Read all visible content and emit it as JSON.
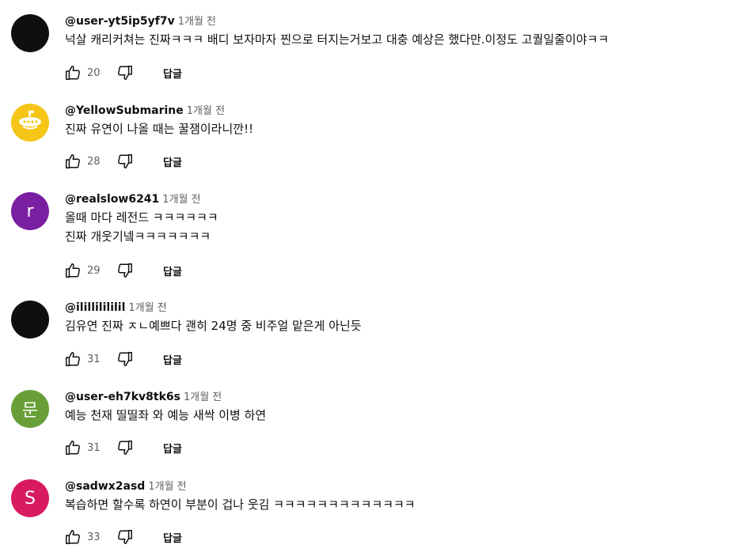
{
  "comments": [
    {
      "author": "@user-yt5ip5yf7v",
      "time": "1개월 전",
      "lines": [
        "넉살 캐리커쳐는 진짜ㅋㅋㅋ 배디 보자마자 찐으로 터지는거보고 대충 예상은 했다만.이정도 고퀄일줄이야ㅋㅋ"
      ],
      "likes": "20",
      "reply": "답글",
      "avatar_color": "#0f0f0f",
      "avatar_letter": ""
    },
    {
      "author": "@YellowSubmarine",
      "time": "1개월 전",
      "lines": [
        "진짜 유연이 나올 때는 꿀잼이라니깐!!"
      ],
      "likes": "28",
      "reply": "답글",
      "avatar_color": "#f5c518",
      "avatar_letter": ""
    },
    {
      "author": "@realslow6241",
      "time": "1개월 전",
      "lines": [
        "올때 마다 레전드 ㅋㅋㅋㅋㅋㅋ",
        "진짜 개웃기넼ㅋㅋㅋㅋㅋㅋㅋ"
      ],
      "likes": "29",
      "reply": "답글",
      "avatar_color": "#7b1fa2",
      "avatar_letter": "r"
    },
    {
      "author": "@ilillilililil",
      "time": "1개월 전",
      "lines": [
        "김유연 진짜 ㅈㄴ예쁘다 괜히 24명 중 비주얼 맡은게 아닌듯"
      ],
      "likes": "31",
      "reply": "답글",
      "avatar_color": "#0f0f0f",
      "avatar_letter": ""
    },
    {
      "author": "@user-eh7kv8tk6s",
      "time": "1개월 전",
      "lines": [
        "예능 천재 띨띨좌 와 예능 새싹 이병 하연"
      ],
      "likes": "31",
      "reply": "답글",
      "avatar_color": "#689f38",
      "avatar_letter": "문"
    },
    {
      "author": "@sadwx2asd",
      "time": "1개월 전",
      "lines": [
        "복습하면 할수록 하연이 부분이 겁나 웃김 ㅋㅋㅋㅋㅋㅋㅋㅋㅋㅋㅋㅋㅋ"
      ],
      "likes": "33",
      "reply": "답글",
      "avatar_color": "#d81b60",
      "avatar_letter": "S"
    }
  ],
  "icons": {
    "like": "thumb-up-icon",
    "dislike": "thumb-down-icon",
    "submarine": "submarine-icon"
  }
}
